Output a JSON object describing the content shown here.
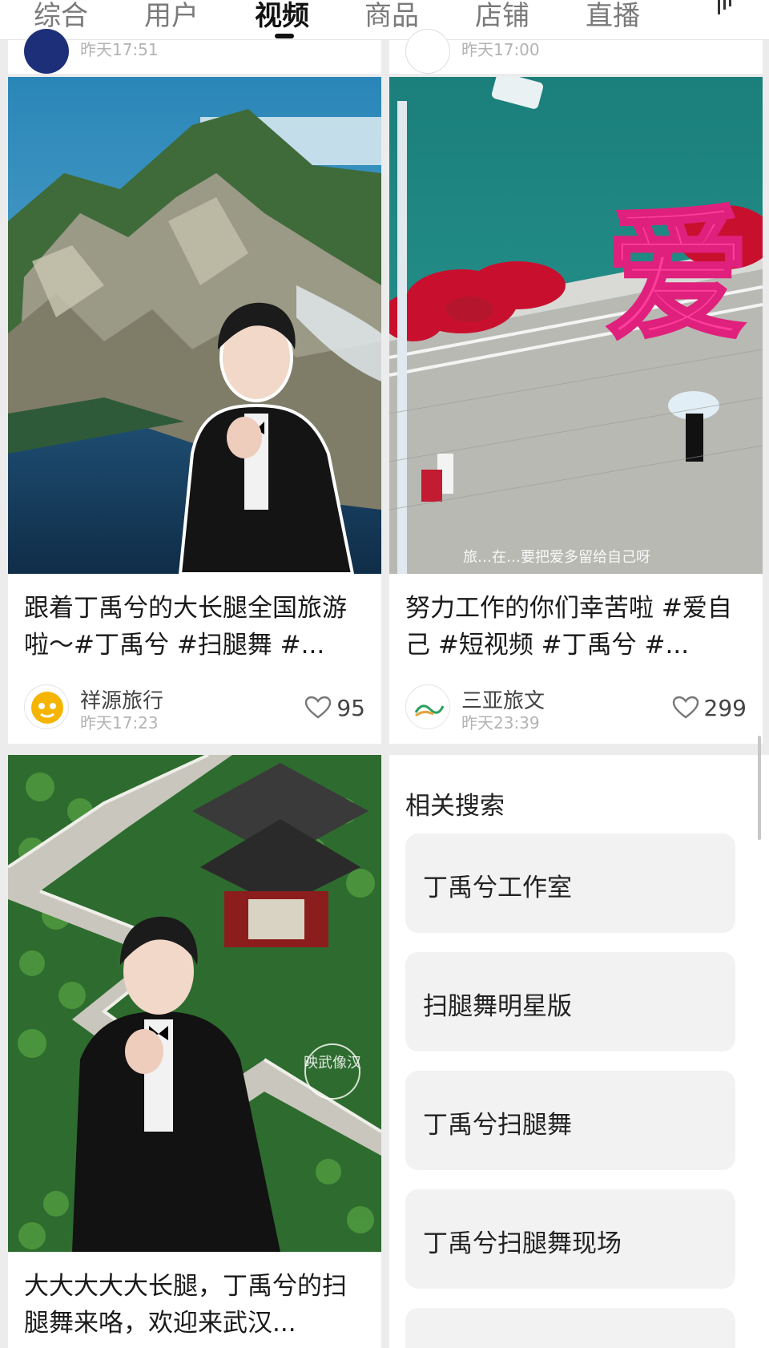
{
  "tabs": [
    "综合",
    "用户",
    "视频",
    "商品",
    "店铺",
    "直播"
  ],
  "active_tab": "视频",
  "partial_cards_above": [
    {
      "time": "昨天17:51"
    },
    {
      "time": "昨天17:00"
    }
  ],
  "videos": [
    {
      "title": "跟着丁禹兮的大长腿全国旅游啦～#丁禹兮 #扫腿舞 #...",
      "author": "祥源旅行",
      "time": "昨天17:23",
      "likes": "95"
    },
    {
      "title": "努力工作的你们幸苦啦 #爱自己 #短视频 #丁禹兮 #...",
      "author": "三亚旅文",
      "time": "昨天23:39",
      "likes": "299",
      "overlay_caption": "旅…在…要把爱多留给自己呀",
      "big_char": "爱"
    },
    {
      "title": "大大大大大长腿，丁禹兮的扫腿舞来咯，欢迎来武汉...",
      "watermark": "映武像汉"
    }
  ],
  "related_search": {
    "title": "相关搜索",
    "items": [
      "丁禹兮工作室",
      "扫腿舞明星版",
      "丁禹兮扫腿舞",
      "丁禹兮扫腿舞现场"
    ]
  },
  "colors": {
    "accent": "#111111",
    "muted": "#b3b3b3",
    "chip_bg": "#f2f2f2"
  }
}
